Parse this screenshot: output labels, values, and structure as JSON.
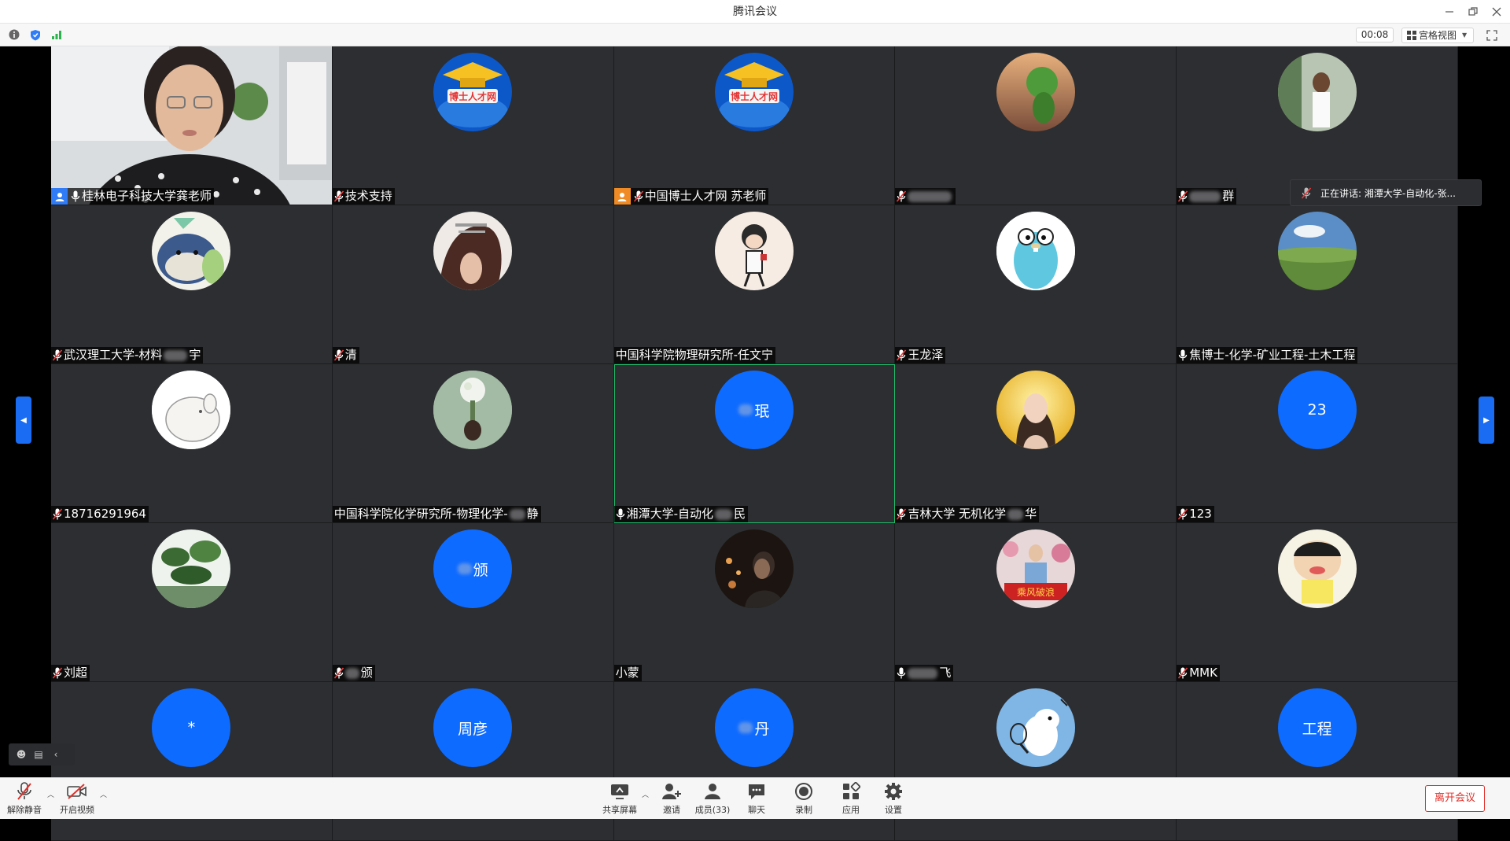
{
  "window": {
    "title": "腾讯会议"
  },
  "topbar": {
    "timer": "00:08",
    "view_label": "宫格视图"
  },
  "speaking": {
    "text": "正在讲话: 湘潭大学-自动化-张..."
  },
  "participants": [
    {
      "name": "桂林电子科技大学龚老师",
      "avatar": "video"
    },
    {
      "name": "技术支持",
      "avatar": "logo"
    },
    {
      "name": "中国博士人才网 苏老师",
      "avatar": "logo"
    },
    {
      "name": "",
      "avatar": "photo"
    },
    {
      "name": "群",
      "avatar": "photo"
    },
    {
      "name": "武汉理工大学-材料",
      "suffix": "宇",
      "avatar": "photo"
    },
    {
      "name": "清",
      "avatar": "photo"
    },
    {
      "name": "中国科学院物理研究所-任文宁",
      "avatar": "photo"
    },
    {
      "name": "王龙泽",
      "avatar": "photo"
    },
    {
      "name": "焦博士-化学-矿业工程-土木工程",
      "avatar": "photo"
    },
    {
      "name": "18716291964",
      "avatar": "photo"
    },
    {
      "name": "中国科学院化学研究所-物理化学-",
      "suffix": "静",
      "avatar": "photo"
    },
    {
      "name": "湘潭大学-自动化",
      "suffix": "民",
      "avatar_text": "珉"
    },
    {
      "name": "吉林大学 无机化学",
      "suffix": "华",
      "avatar": "photo"
    },
    {
      "name": "123",
      "avatar_text": "23"
    },
    {
      "name": "刘超",
      "avatar": "photo"
    },
    {
      "name": "颁",
      "avatar_text": "颁"
    },
    {
      "name": "小蒙",
      "avatar": "photo"
    },
    {
      "name": "飞",
      "avatar": "photo"
    },
    {
      "name": "MMK",
      "avatar": "photo"
    },
    {
      "name": "",
      "avatar_text": "*"
    },
    {
      "name": "",
      "avatar_text": "周彦"
    },
    {
      "name": "",
      "avatar_text": "丹"
    },
    {
      "name": "",
      "avatar": "photo"
    },
    {
      "name": "",
      "avatar_text": "工程"
    }
  ],
  "bottom": {
    "unmute": "解除静音",
    "video": "开启视频",
    "share": "共享屏幕",
    "invite": "邀请",
    "members": "成员(33)",
    "chat": "聊天",
    "record": "录制",
    "apps": "应用",
    "settings": "设置",
    "leave": "离开会议"
  },
  "colors": {
    "accent": "#0e6bff",
    "leave": "#e0302a",
    "tile_bg": "#2c2e31"
  }
}
